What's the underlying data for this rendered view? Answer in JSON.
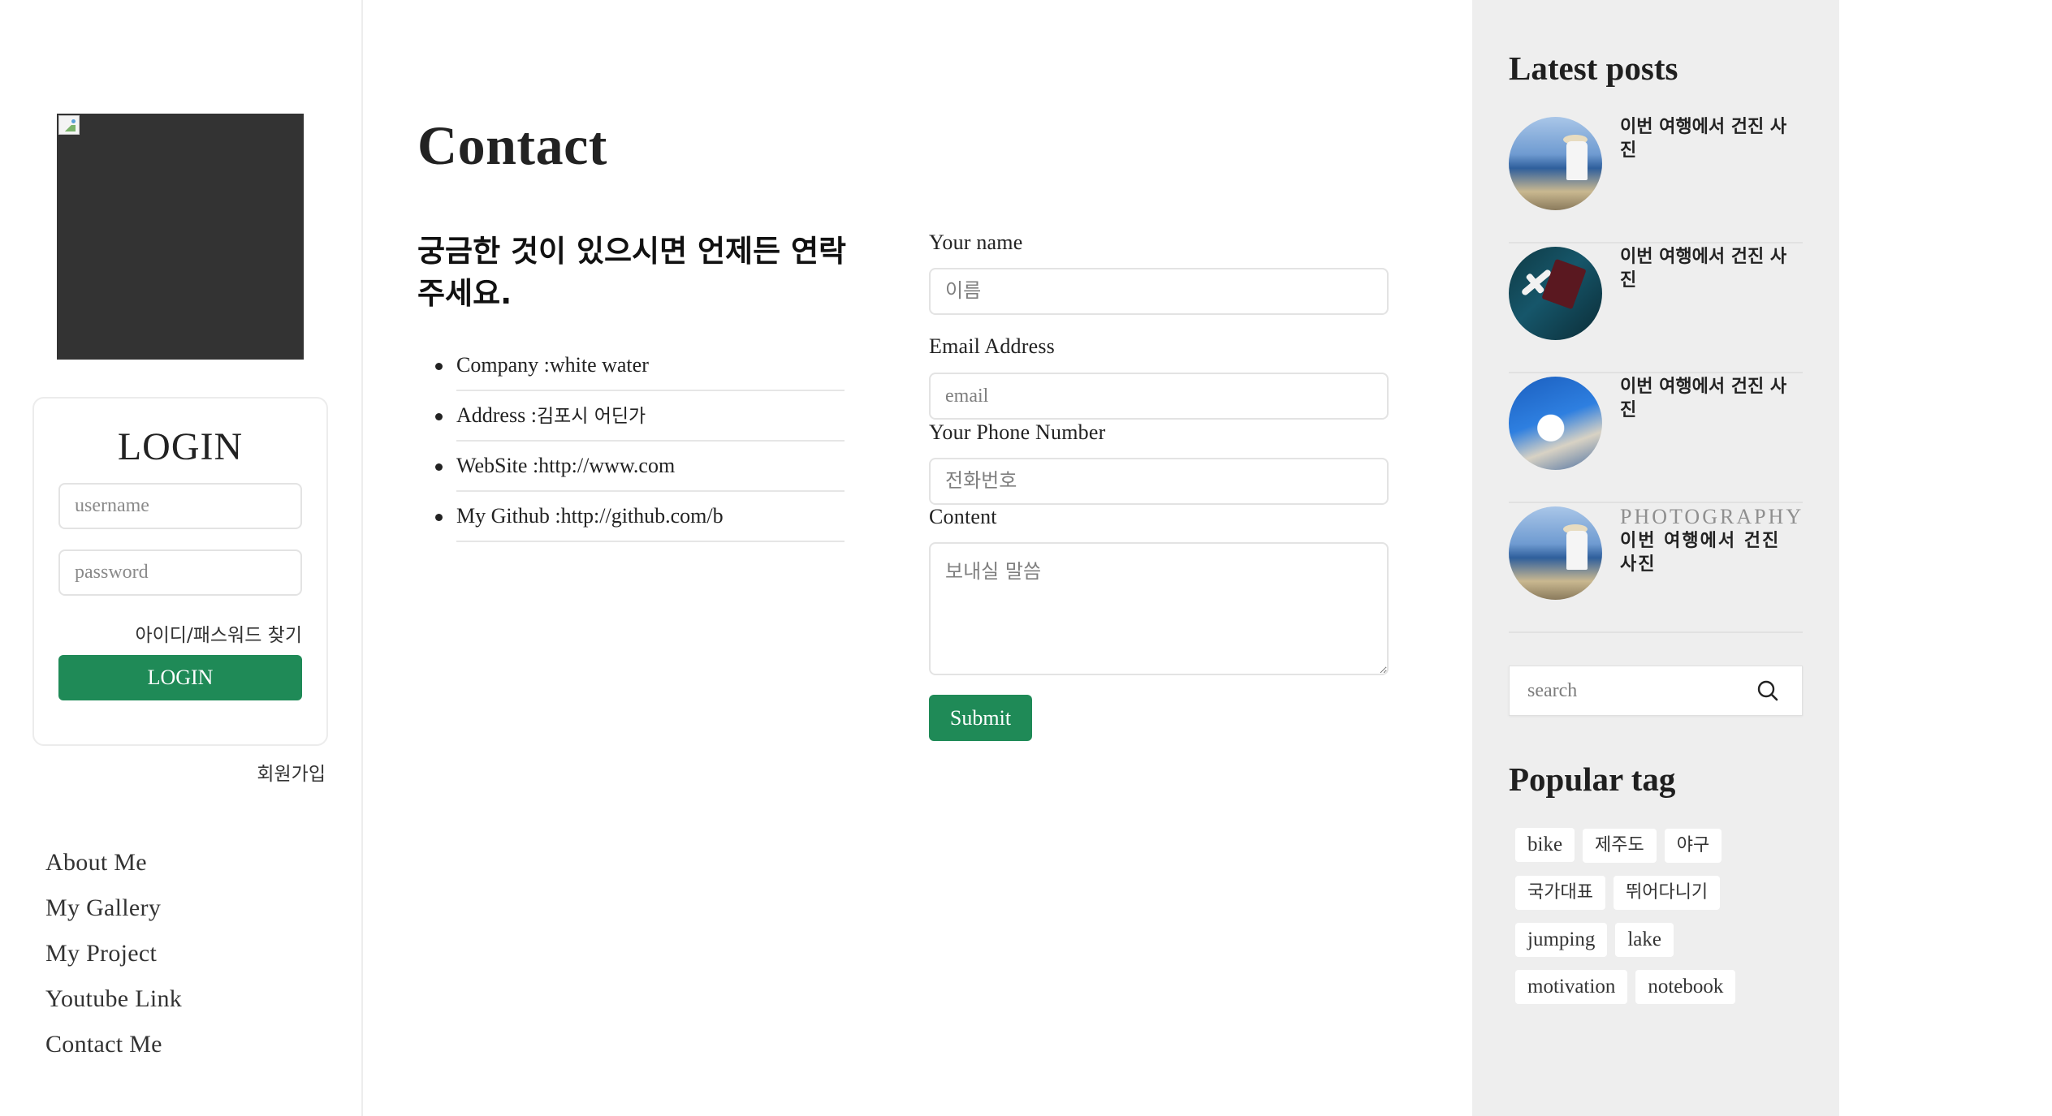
{
  "left": {
    "login": {
      "title": "LOGIN",
      "username_placeholder": "username",
      "password_placeholder": "password",
      "find_link": "아이디/패스워드 찾기",
      "button_label": "LOGIN"
    },
    "signup_link": "회원가입",
    "nav": [
      {
        "label": "About Me"
      },
      {
        "label": "My Gallery"
      },
      {
        "label": "My Project"
      },
      {
        "label": "Youtube Link"
      },
      {
        "label": "Contact Me"
      }
    ]
  },
  "main": {
    "title": "Contact",
    "intro_heading": "궁금한 것이 있으시면 언제든 연락주세요.",
    "info": [
      {
        "label": "Company :",
        "value": "white water"
      },
      {
        "label": "Address :",
        "value": "김포시 어딘가"
      },
      {
        "label": "WebSite :",
        "value": "http://www.com"
      },
      {
        "label": "My Github :",
        "value": "http://github.com/b"
      }
    ],
    "form": {
      "name_label": "Your name",
      "name_placeholder": "이름",
      "email_label": "Email Address",
      "email_placeholder": "email",
      "phone_label": "Your Phone Number",
      "phone_placeholder": "전화번호",
      "content_label": "Content",
      "content_placeholder": "보내실 말씀",
      "submit_label": "Submit"
    }
  },
  "right": {
    "latest_heading": "Latest posts",
    "posts": [
      {
        "title": "이번 여행에서 건진 사진",
        "thumb": "seaside-traveler"
      },
      {
        "title": "이번 여행에서 건진 사진",
        "thumb": "travel-flatlay"
      },
      {
        "title": "이번 여행에서 건진 사진",
        "thumb": "santorini"
      },
      {
        "category": "PHOTOGRAPHY",
        "title": "이번 여행에서 건진 사진",
        "thumb": "seaside-traveler"
      }
    ],
    "search_placeholder": "search",
    "search_icon": "search-icon",
    "popular_heading": "Popular tag",
    "tags": [
      "bike",
      "제주도",
      "야구",
      "국가대표",
      "뛰어다니기",
      "jumping",
      "lake",
      "motivation",
      "notebook"
    ]
  },
  "colors": {
    "accent_green": "#1f8a57",
    "sidebar_bg": "#eeeeee",
    "profile_bg": "#333333"
  }
}
